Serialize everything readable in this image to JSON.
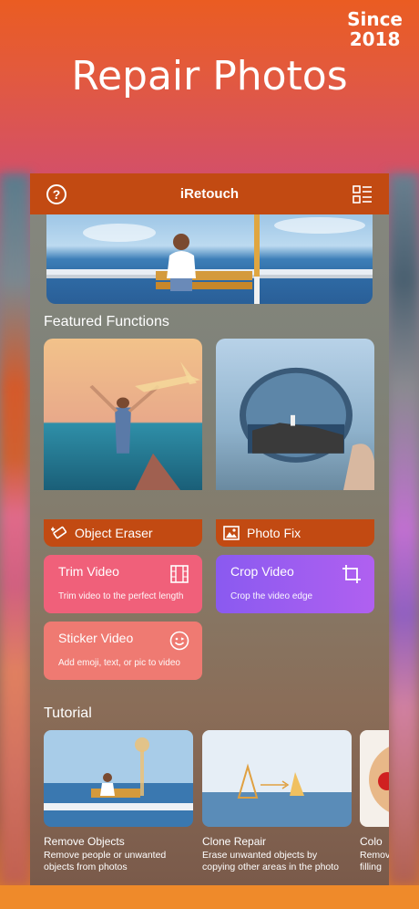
{
  "promo": {
    "since_line1": "Since",
    "since_line2": "2018",
    "headline": "Repair Photos"
  },
  "app": {
    "title": "iRetouch",
    "help_label": "?",
    "menu_icon": "list-grid-icon"
  },
  "featured": {
    "heading": "Featured Functions",
    "cards": [
      {
        "label": "Object Eraser",
        "icon": "eraser-wand-icon"
      },
      {
        "label": "Photo Fix",
        "icon": "photo-icon"
      }
    ],
    "tools": [
      {
        "label": "Trim Video",
        "sub": "Trim video to the perfect length",
        "icon": "film-strip-icon",
        "color": "#f0607a"
      },
      {
        "label": "Crop Video",
        "sub": "Crop the video edge",
        "icon": "crop-icon",
        "color": "#9a5cf0"
      },
      {
        "label": "Sticker Video",
        "sub": "Add emoji, text, or pic to video",
        "icon": "smiley-icon",
        "color": "#ef7a72"
      }
    ]
  },
  "tutorial": {
    "heading": "Tutorial",
    "items": [
      {
        "title": "Remove Objects",
        "desc": "Remove people or unwanted objects from photos"
      },
      {
        "title": "Clone Repair",
        "desc": "Erase unwanted objects by copying other areas in the photo"
      },
      {
        "title": "Colo",
        "desc": "Remov filling"
      }
    ]
  },
  "colors": {
    "accent": "#c24a12",
    "promo_top": "#ea5c22",
    "promo_bottom": "#d45067"
  }
}
